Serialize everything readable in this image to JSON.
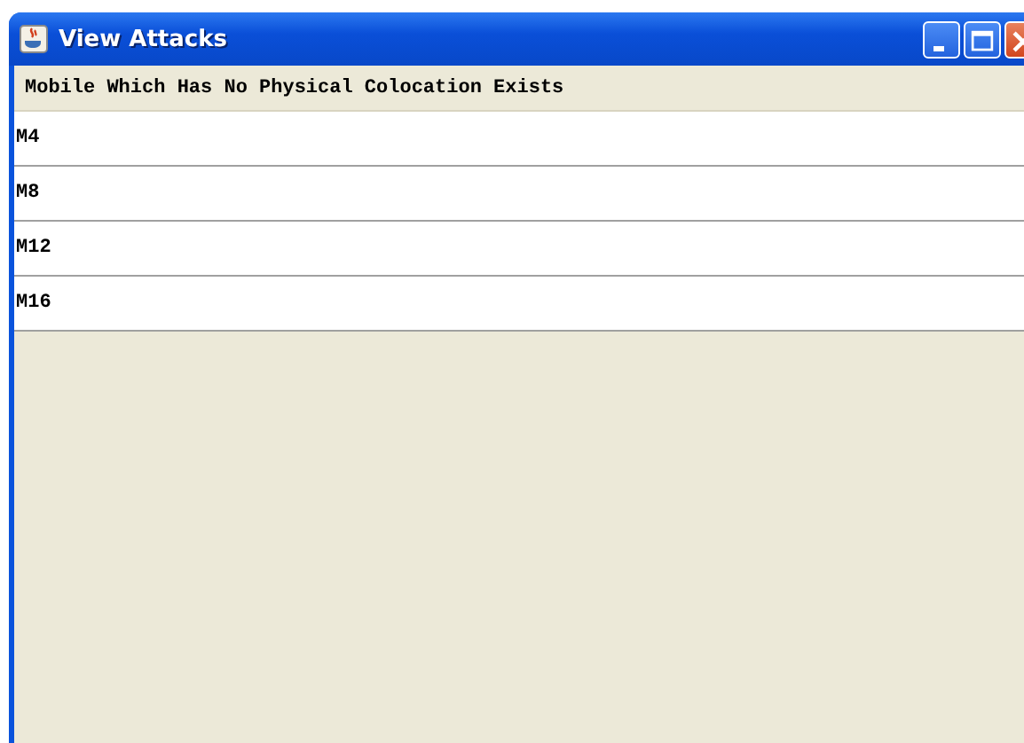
{
  "window": {
    "title": "View Attacks"
  },
  "list": {
    "heading": "Mobile Which Has No Physical Colocation Exists",
    "items": [
      "M4",
      "M8",
      "M12",
      "M16"
    ]
  }
}
